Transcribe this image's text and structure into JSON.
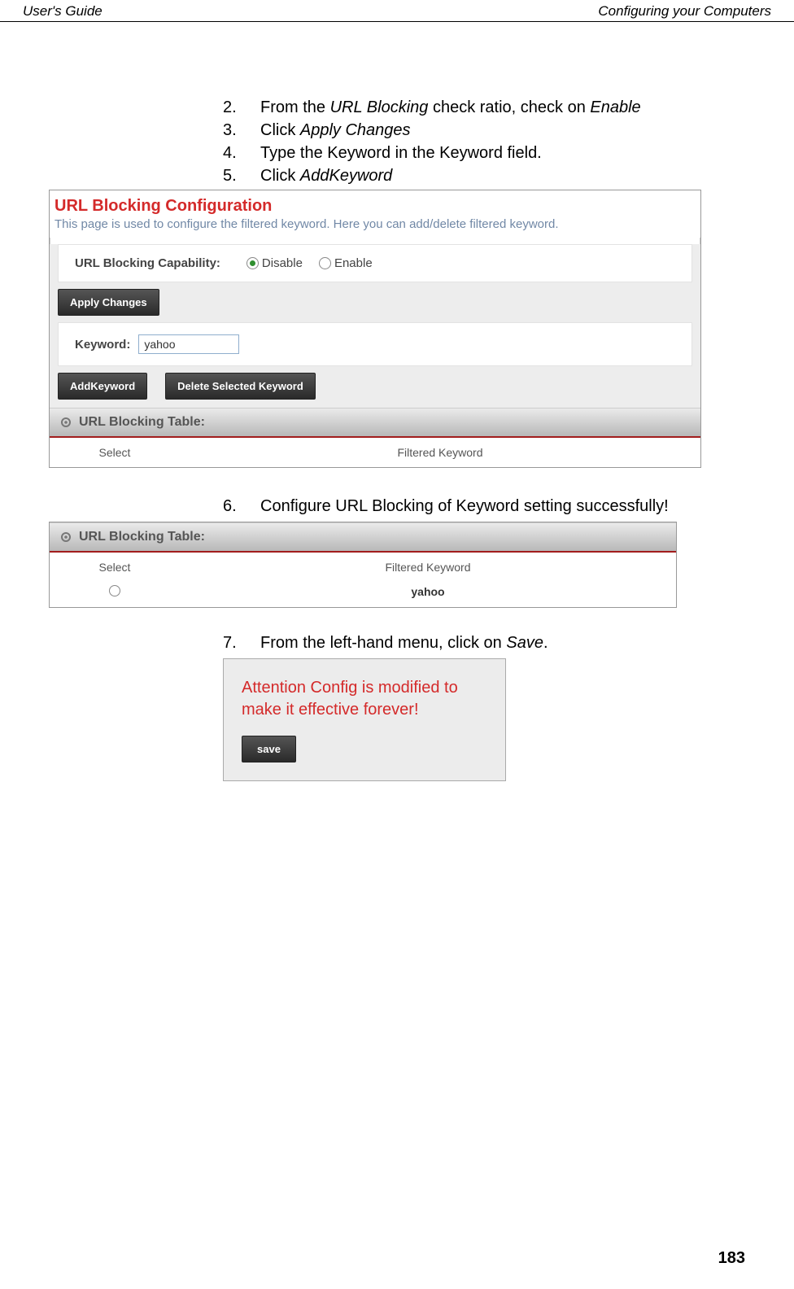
{
  "header": {
    "left": "User's Guide",
    "right": "Configuring your Computers"
  },
  "steps1": [
    {
      "n": "2.",
      "pre": "From the ",
      "em1": "URL Blocking",
      "mid": " check ratio, check on ",
      "em2": "Enable"
    },
    {
      "n": "3.",
      "pre": "Click ",
      "em1": "Apply Changes",
      "mid": "",
      "em2": ""
    },
    {
      "n": "4.",
      "pre": "Type the Keyword in the Keyword field.",
      "em1": "",
      "mid": "",
      "em2": ""
    },
    {
      "n": "5.",
      "pre": "Click ",
      "em1": "AddKeyword",
      "mid": "",
      "em2": ""
    }
  ],
  "shot1": {
    "title": "URL Blocking Configuration",
    "desc": "This page is used to configure the filtered keyword. Here you can add/delete filtered keyword.",
    "cap_label": "URL Blocking Capability:",
    "disable": "Disable",
    "enable": "Enable",
    "apply": "Apply Changes",
    "kw_label": "Keyword:",
    "kw_value": "yahoo",
    "add": "AddKeyword",
    "del": "Delete Selected Keyword",
    "tablebar": "URL Blocking Table:",
    "col1": "Select",
    "col2": "Filtered Keyword"
  },
  "step6": {
    "n": "6.",
    "text": "Configure URL Blocking of Keyword setting successfully!"
  },
  "shot2": {
    "tablebar": "URL Blocking Table:",
    "col1": "Select",
    "col2": "Filtered Keyword",
    "row_val": "yahoo"
  },
  "step7": {
    "n": "7.",
    "pre": "From the left-hand menu, click on ",
    "em": "Save",
    "post": "."
  },
  "shot3": {
    "attention": "Attention Config is modified to make it effective forever!",
    "save": "save"
  },
  "page_number": "183"
}
